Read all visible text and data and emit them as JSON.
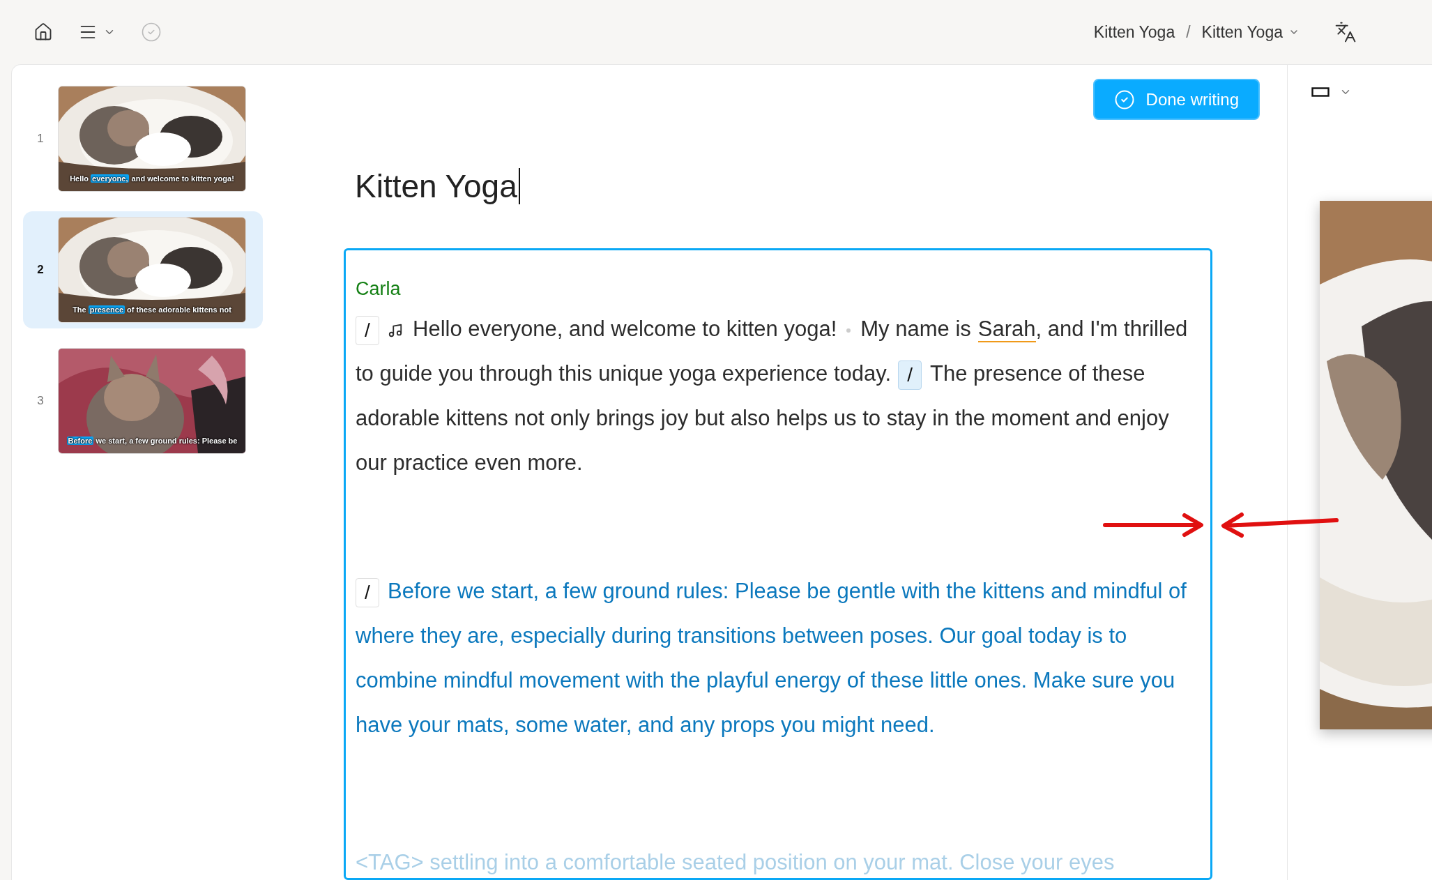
{
  "toolbar": {
    "breadcrumb": [
      "Kitten Yoga",
      "Kitten Yoga"
    ],
    "separator": "/"
  },
  "slides": [
    {
      "number": "1",
      "selected": false,
      "kind": "basket",
      "caption": {
        "before": "Hello ",
        "highlight": "everyone,",
        "after": " and welcome to kitten yoga!"
      }
    },
    {
      "number": "2",
      "selected": true,
      "kind": "basket",
      "caption": {
        "before": "The ",
        "highlight": "presence",
        "after": " of these adorable kittens not"
      }
    },
    {
      "number": "3",
      "selected": false,
      "kind": "blanket",
      "caption": {
        "highlight": "Before",
        "after": " we start, a few ground rules: Please be"
      }
    }
  ],
  "done_button": "Done writing",
  "title": "Kitten Yoga",
  "script": {
    "speaker": "Carla",
    "paragraphs": [
      {
        "kind": "current",
        "segments": [
          {
            "kind": "tag",
            "text": "/",
            "selected": false
          },
          {
            "kind": "music"
          },
          {
            "kind": "text",
            "text": "Hello everyone, and welcome to kitten yoga!"
          },
          {
            "kind": "pause"
          },
          {
            "kind": "text",
            "text": "My name is"
          },
          {
            "kind": "name",
            "text": "Sarah"
          },
          {
            "kind": "text",
            "text": ", and I'm thrilled to guide you through this unique yoga experience today."
          },
          {
            "kind": "tag",
            "text": "/",
            "selected": true
          },
          {
            "kind": "text",
            "text": "The presence of these adorable kittens not only brings joy but also helps us to stay in the moment and enjoy our practice even more."
          }
        ]
      },
      {
        "kind": "upcoming",
        "segments": [
          {
            "kind": "tag",
            "text": "/",
            "selected": false
          },
          {
            "kind": "text",
            "text": "Before we start, a few ground rules: Please be gentle with the kittens and mindful of where they are, especially during transitions between poses. Our goal today is to combine mindful movement with the playful energy of these little ones. Make sure you have your mats, some water, and any props you might need."
          }
        ]
      }
    ],
    "faded_line": "<TAG> settling into a comfortable seated position on your mat. Close your eyes"
  },
  "annotations": [
    {
      "kind": "arrow-right"
    },
    {
      "kind": "arrow-left"
    }
  ]
}
